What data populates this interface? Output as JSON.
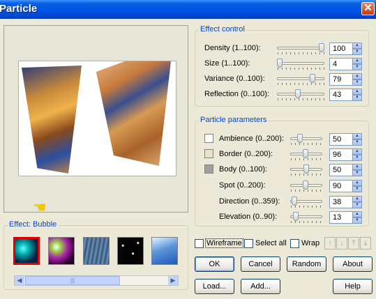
{
  "window": {
    "title": "Particle",
    "close_glyph": "✕"
  },
  "preview": {
    "pointer_icon": "pointing-hand-icon"
  },
  "effect": {
    "group_label": "Effect: Bubble",
    "thumbnails": [
      "bubble-effect",
      "color-bubble-effect",
      "rain-effect",
      "stars-effect",
      "cloud-effect"
    ],
    "selected_index": 0
  },
  "effect_control": {
    "label": "Effect control",
    "rows": [
      {
        "label": "Density (1..100):",
        "value": "100"
      },
      {
        "label": "Size (1..100):",
        "value": "4"
      },
      {
        "label": "Variance (0..100):",
        "value": "79"
      },
      {
        "label": "Reflection (0..100):",
        "value": "43"
      }
    ]
  },
  "particle_parameters": {
    "label": "Particle parameters",
    "rows": [
      {
        "label": "Ambience (0..200):",
        "value": "50",
        "swatch": "#ffffff"
      },
      {
        "label": "Border (0..200):",
        "value": "96",
        "swatch": "#e9e2c9"
      },
      {
        "label": "Body (0..100):",
        "value": "50",
        "swatch": "#a0a0a0"
      },
      {
        "label": "Spot (0..200):",
        "value": "90"
      },
      {
        "label": "Direction (0..359):",
        "value": "38"
      },
      {
        "label": "Elevation (0..90):",
        "value": "13"
      }
    ]
  },
  "options": {
    "wireframe": "Wireframe",
    "select_all": "Select all",
    "wrap": "Wrap"
  },
  "buttons": {
    "ok": "OK",
    "cancel": "Cancel",
    "random": "Random",
    "about": "About",
    "load": "Load...",
    "add": "Add...",
    "help": "Help"
  }
}
